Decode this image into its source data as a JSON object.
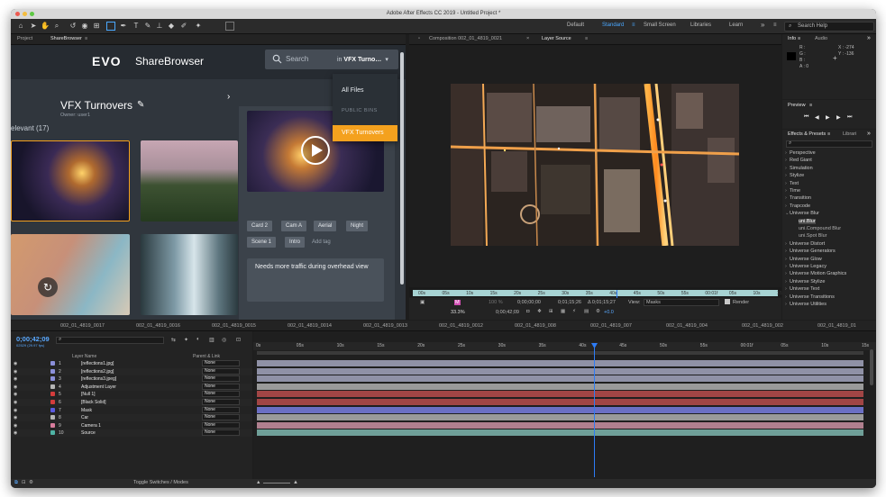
{
  "window": {
    "title": "Adobe After Effects CC 2019 - Untitled Project *"
  },
  "workspaces": [
    {
      "label": "Default",
      "active": false
    },
    {
      "label": "Standard",
      "active": true
    },
    {
      "label": "Small Screen",
      "active": false
    },
    {
      "label": "Libraries",
      "active": false
    },
    {
      "label": "Learn",
      "active": false
    }
  ],
  "help": {
    "placeholder": "Search Help"
  },
  "left_panel": {
    "tabs": [
      "Project",
      "ShareBrowser"
    ]
  },
  "sharebrowser": {
    "logo": "EVO",
    "brand": "ShareBrowser",
    "search_placeholder": "Search",
    "search_scope_prefix": "in",
    "search_scope_value": "VFX Turnovers",
    "bin_title": "VFX Turnovers",
    "owner": "Owner: user1",
    "relevant_label": "elevant (17)",
    "dropdown": {
      "all_files": "All Files",
      "section": "PUBLIC BINS",
      "selected": "VFX Turnovers"
    },
    "tags": [
      "Card 2",
      "Cam A",
      "Aerial",
      "Night",
      "Scene 1",
      "Intro"
    ],
    "add_tag": "Add tag",
    "note": "Needs more traffic during overhead view"
  },
  "composition": {
    "tab_name": "Composition 002_01_4819_0021",
    "layer_tab": "Layer Source",
    "ruler_labels": [
      "00s",
      "05s",
      "10s",
      "15s",
      "20s",
      "25s",
      "30s",
      "35s",
      "40s",
      "45s",
      "50s",
      "55s",
      "00:01f",
      "05s",
      "10s",
      "15s"
    ],
    "zoom": "33.3%",
    "current_time": "0;00;42;09",
    "start_time": "0;00;00;00",
    "end_time": "0;01;15;26",
    "duration": "Δ 0;01;15;27",
    "view_label": "View:",
    "view_value": "Masks",
    "render_label": "Render",
    "offset": "+0.0"
  },
  "info_panel": {
    "tabs": [
      "Info",
      "Audio"
    ],
    "rgb": [
      "R :",
      "G :",
      "B :",
      "A : 0"
    ],
    "x": "X : -274",
    "y": "Y : -136"
  },
  "preview_panel": {
    "title": "Preview"
  },
  "effects_panel": {
    "tabs": [
      "Effects & Presets",
      "Librari"
    ],
    "categories": [
      "Perspective",
      "Red Giant",
      "Simulation",
      "Stylize",
      "Text",
      "Time",
      "Transition",
      "Trapcode",
      "Universe Blur"
    ],
    "blur_items": [
      "uni.Blur",
      "uni.Compound Blur",
      "uni.Spot Blur"
    ],
    "more_categories": [
      "Universe Distort",
      "Universe Generators",
      "Universe Glow",
      "Universe Legacy",
      "Universe Motion Graphics",
      "Universe Stylize",
      "Universe Text",
      "Universe Transitions",
      "Universe Utilities"
    ]
  },
  "timeline": {
    "tabs": [
      "002_01_4819_0017",
      "002_01_4819_0016",
      "002_01_4819_0015",
      "002_01_4819_0014",
      "002_01_4819_0013",
      "002_01_4819_0012",
      "002_01_4819_008",
      "002_01_4819_007",
      "002_01_4819_004",
      "002_01_4819_002",
      "002_01_4819_01"
    ],
    "timecode": "0;00;42;09",
    "fps": "02529 (29.97 fps)",
    "layer_name_header": "Layer Name",
    "parent_header": "Parent & Link",
    "ruler": [
      "0s",
      "05s",
      "10s",
      "15s",
      "20s",
      "25s",
      "30s",
      "35s",
      "40s",
      "45s",
      "50s",
      "55s",
      "00:01f",
      "05s",
      "10s",
      "15s"
    ],
    "layers": [
      {
        "idx": "1",
        "name": "[reflections1.jpg]",
        "color": "#8b8fd9",
        "parent": "None",
        "bar": "#8f91a6"
      },
      {
        "idx": "2",
        "name": "[reflections2.jpg]",
        "color": "#8b8fd9",
        "parent": "None",
        "bar": "#8f91a6"
      },
      {
        "idx": "3",
        "name": "[reflections3.jpeg]",
        "color": "#8b8fd9",
        "parent": "None",
        "bar": "#8f91a6"
      },
      {
        "idx": "4",
        "name": "Adjustment Layer",
        "color": "#b5b5b5",
        "parent": "None",
        "bar": "#9a9a9a"
      },
      {
        "idx": "5",
        "name": "[Null 1]",
        "color": "#d33c3c",
        "parent": "None",
        "bar": "#a14545"
      },
      {
        "idx": "6",
        "name": "[Black Solid]",
        "color": "#d33c3c",
        "parent": "None",
        "bar": "#a14545"
      },
      {
        "idx": "7",
        "name": "Mask",
        "color": "#5a5adf",
        "parent": "None",
        "bar": "#6b6fc4"
      },
      {
        "idx": "8",
        "name": "Car",
        "color": "#b5b5b5",
        "parent": "None",
        "bar": "#9a9a9a"
      },
      {
        "idx": "9",
        "name": "Camera 1",
        "color": "#d87c9c",
        "parent": "None",
        "bar": "#b0808f"
      },
      {
        "idx": "10",
        "name": "Source",
        "color": "#4fb3a5",
        "parent": "None",
        "bar": "#6f9f98"
      }
    ],
    "footer": "Toggle Switches / Modes"
  }
}
